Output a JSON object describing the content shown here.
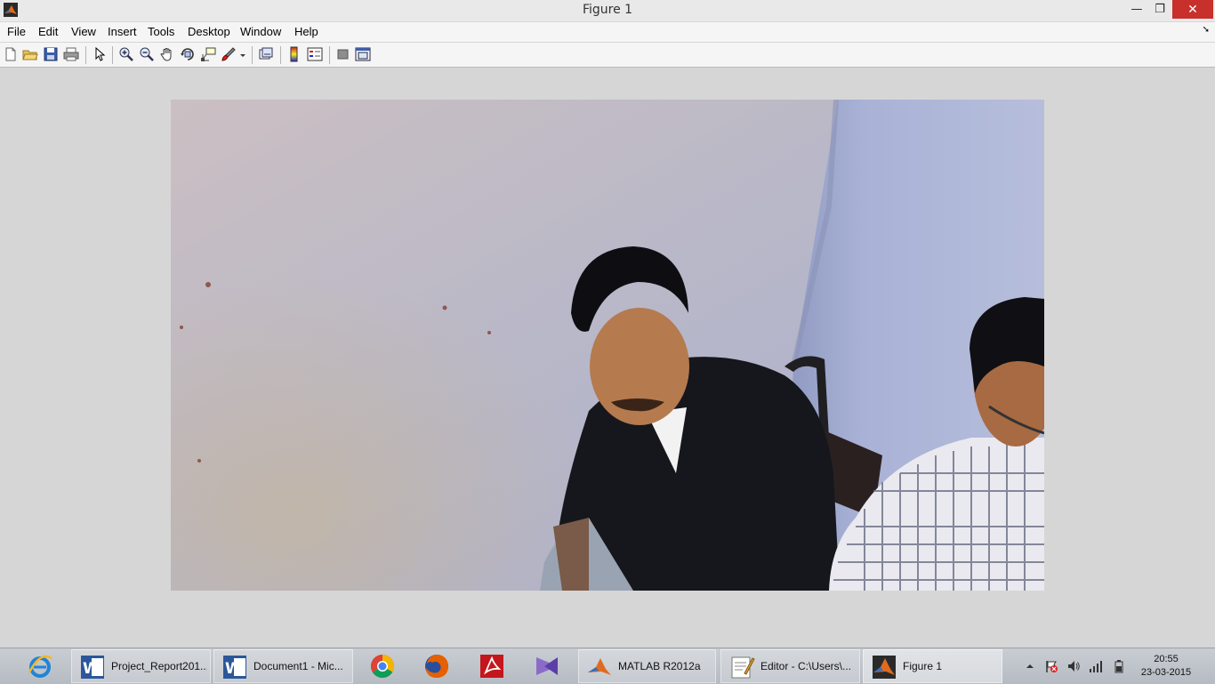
{
  "window": {
    "title": "Figure 1",
    "minimize_glyph": "—",
    "maximize_glyph": "❐",
    "close_glyph": "✕"
  },
  "menu": {
    "items": [
      "File",
      "Edit",
      "View",
      "Insert",
      "Tools",
      "Desktop",
      "Window",
      "Help"
    ],
    "dock_glyph": "➘"
  },
  "toolbar": {
    "icons": [
      "new-figure-icon",
      "open-file-icon",
      "save-figure-icon",
      "print-figure-icon",
      "edit-plot-arrow-icon",
      "zoom-in-icon",
      "zoom-out-icon",
      "pan-hand-icon",
      "rotate-3d-icon",
      "data-cursor-icon",
      "brush-icon",
      "link-plot-icon",
      "insert-colorbar-icon",
      "insert-legend-icon",
      "hide-plot-tools-icon",
      "show-plot-tools-icon"
    ]
  },
  "figure": {
    "image_description_icon": "webcam-photo"
  },
  "taskbar": {
    "apps": [
      {
        "icon": "internet-explorer-icon",
        "label": ""
      },
      {
        "icon": "word-icon",
        "label": "Project_Report201..."
      },
      {
        "icon": "word-icon",
        "label": "Document1 - Mic..."
      },
      {
        "icon": "chrome-icon",
        "label": ""
      },
      {
        "icon": "firefox-icon",
        "label": ""
      },
      {
        "icon": "acrobat-icon",
        "label": ""
      },
      {
        "icon": "visual-studio-icon",
        "label": ""
      },
      {
        "icon": "matlab-icon",
        "label": "MATLAB  R2012a"
      },
      {
        "icon": "editor-icon",
        "label": "Editor - C:\\Users\\..."
      },
      {
        "icon": "matlab-figure-icon",
        "label": "Figure 1"
      }
    ],
    "clock_time": "20:55",
    "clock_date": "23-03-2015"
  },
  "colors": {
    "accent_close": "#c7302b",
    "matlab_orange": "#e06b1f"
  }
}
